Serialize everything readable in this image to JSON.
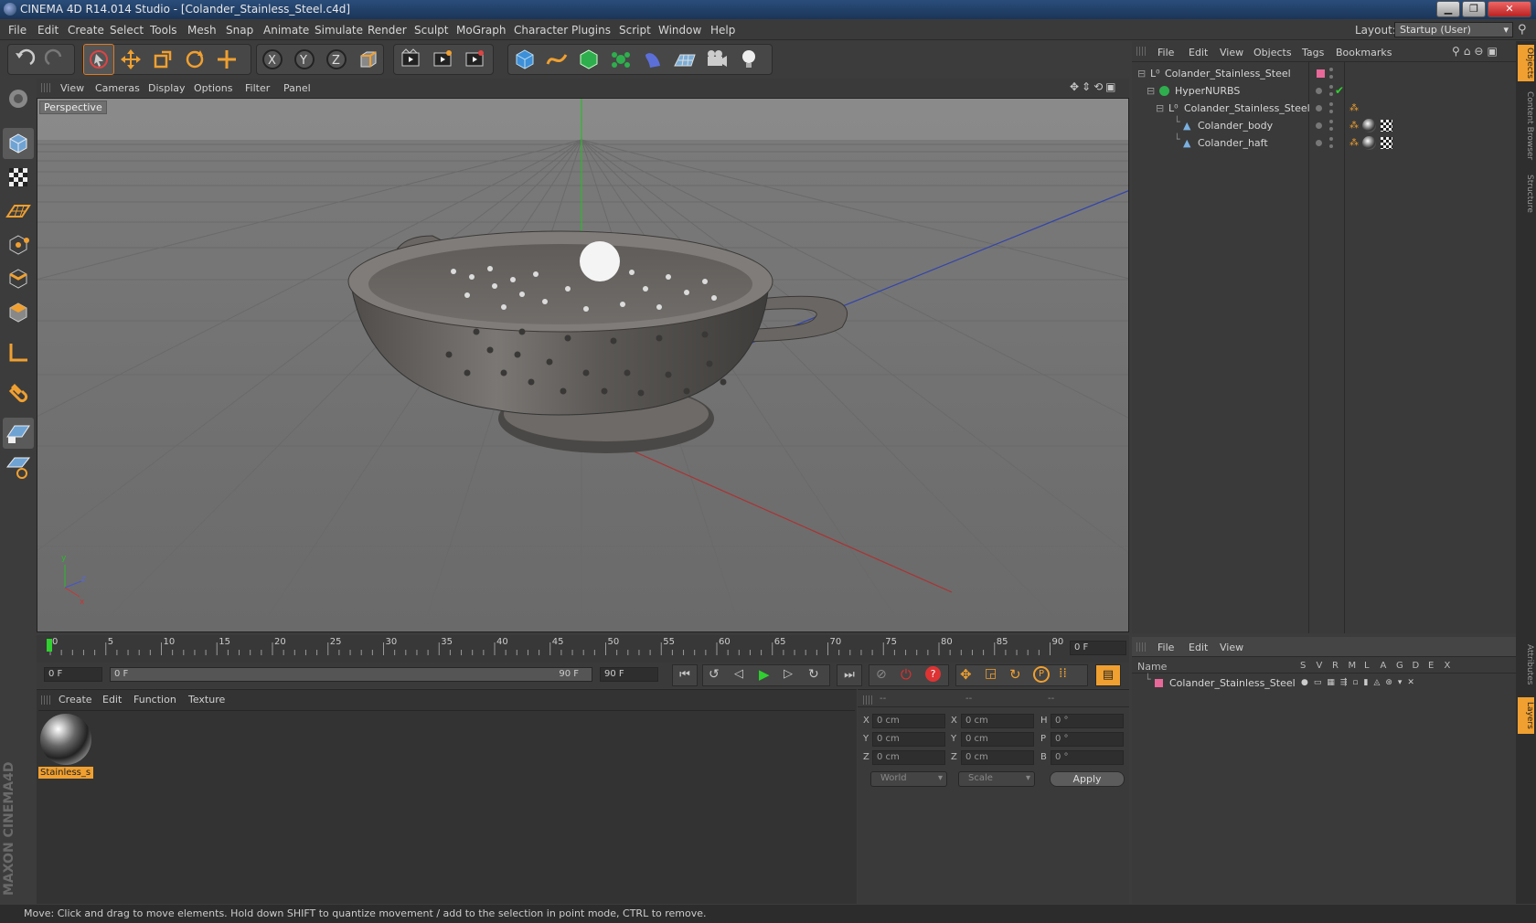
{
  "window": {
    "title": "CINEMA 4D R14.014 Studio - [Colander_Stainless_Steel.c4d]"
  },
  "menubar": {
    "items": [
      "File",
      "Edit",
      "Create",
      "Select",
      "Tools",
      "Mesh",
      "Snap",
      "Animate",
      "Simulate",
      "Render",
      "Sculpt",
      "MoGraph",
      "Character",
      "Plugins",
      "Script",
      "Window",
      "Help"
    ],
    "layout_label": "Layout:",
    "layout_value": "Startup (User)"
  },
  "viewport": {
    "menu": [
      "View",
      "Cameras",
      "Display",
      "Options",
      "Filter",
      "Panel"
    ],
    "label": "Perspective"
  },
  "timeline": {
    "ticks": [
      "0",
      "5",
      "10",
      "15",
      "20",
      "25",
      "30",
      "35",
      "40",
      "45",
      "50",
      "55",
      "60",
      "65",
      "70",
      "75",
      "80",
      "85",
      "90"
    ],
    "current_frame": "0 F"
  },
  "timecontrols": {
    "start": "0 F",
    "range_start": "0 F",
    "range_end": "90 F",
    "end": "90 F"
  },
  "materials": {
    "menu": [
      "Create",
      "Edit",
      "Function",
      "Texture"
    ],
    "items": [
      {
        "name": "Stainless_s"
      }
    ]
  },
  "coords": {
    "headers": [
      "--",
      "--",
      "--"
    ],
    "rows": [
      {
        "a": "X",
        "v1": "0 cm",
        "b": "X",
        "v2": "0 cm",
        "c": "H",
        "v3": "0 °"
      },
      {
        "a": "Y",
        "v1": "0 cm",
        "b": "Y",
        "v2": "0 cm",
        "c": "P",
        "v3": "0 °"
      },
      {
        "a": "Z",
        "v1": "0 cm",
        "b": "Z",
        "v2": "0 cm",
        "c": "B",
        "v3": "0 °"
      }
    ],
    "world": "World",
    "scale": "Scale",
    "apply": "Apply"
  },
  "objects": {
    "menu": [
      "File",
      "Edit",
      "View",
      "Objects",
      "Tags",
      "Bookmarks"
    ],
    "tree": [
      {
        "name": "Colander_Stainless_Steel",
        "depth": 0
      },
      {
        "name": "HyperNURBS",
        "depth": 1
      },
      {
        "name": "Colander_Stainless_Steel",
        "depth": 2
      },
      {
        "name": "Colander_body",
        "depth": 3
      },
      {
        "name": "Colander_haft",
        "depth": 3
      }
    ]
  },
  "layers": {
    "menu": [
      "File",
      "Edit",
      "View"
    ],
    "header": "Name",
    "columns": [
      "S",
      "V",
      "R",
      "M",
      "L",
      "A",
      "G",
      "D",
      "E",
      "X"
    ],
    "rows": [
      "Colander_Stainless_Steel"
    ]
  },
  "right_tabs": [
    "Objects",
    "Content Browser",
    "Structure",
    "Attributes",
    "Layers"
  ],
  "brand": "MAXON CINEMA4D",
  "status": {
    "text": "Move: Click and drag to move elements. Hold down SHIFT to quantize movement / add to the selection in point mode, CTRL to remove."
  },
  "colors": {
    "accent": "#f0a030",
    "layer": "#e8689a",
    "selection": "#1d4d86"
  }
}
